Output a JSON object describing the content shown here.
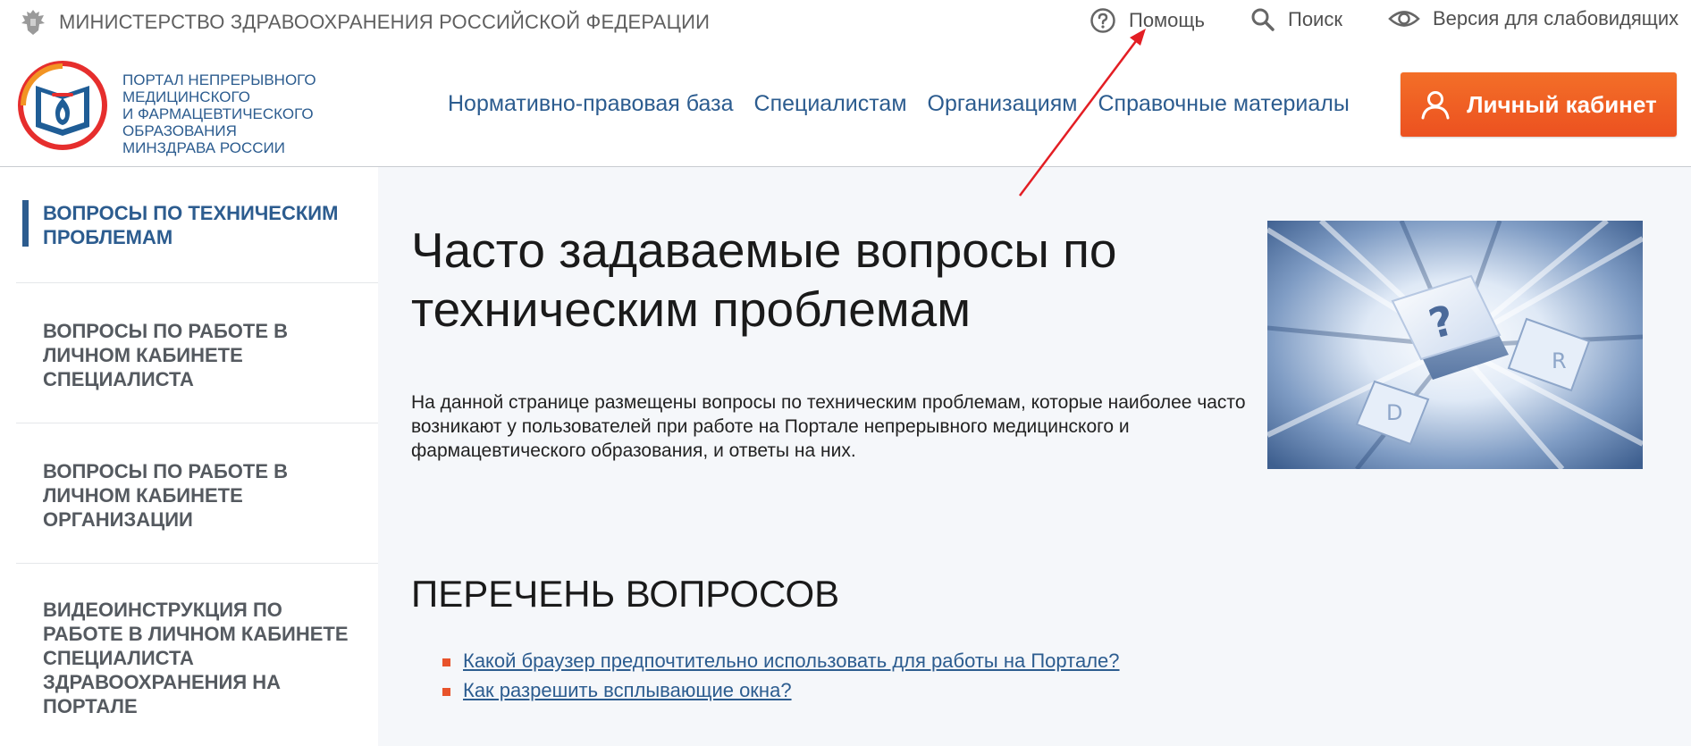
{
  "topbar": {
    "ministry": "МИНИСТЕРСТВО ЗДРАВООХРАНЕНИЯ РОССИЙСКОЙ ФЕДЕРАЦИИ",
    "help": "Помощь",
    "search": "Поиск",
    "accessibility": "Версия для слабовидящих"
  },
  "header": {
    "portal_lines": [
      "ПОРТАЛ НЕПРЕРЫВНОГО",
      "МЕДИЦИНСКОГО",
      "И ФАРМАЦЕВТИЧЕСКОГО ОБРАЗОВАНИЯ",
      "МИНЗДРАВА РОССИИ"
    ],
    "nav": [
      "Нормативно-правовая база",
      "Специалистам",
      "Организациям",
      "Справочные материалы"
    ],
    "cabinet_button": "Личный кабинет"
  },
  "sidebar": {
    "items": [
      {
        "label": "ВОПРОСЫ ПО ТЕХНИЧЕСКИМ ПРОБЛЕМАМ",
        "active": true
      },
      {
        "label": "ВОПРОСЫ ПО РАБОТЕ В ЛИЧНОМ КАБИНЕТЕ СПЕЦИАЛИСТА",
        "active": false
      },
      {
        "label": "ВОПРОСЫ ПО РАБОТЕ В ЛИЧНОМ КАБИНЕТЕ ОРГАНИЗАЦИИ",
        "active": false
      },
      {
        "label": "ВИДЕОИНСТРУКЦИЯ ПО РАБОТЕ В ЛИЧНОМ КАБИНЕТЕ СПЕЦИАЛИСТА ЗДРАВООХРАНЕНИЯ НА ПОРТАЛЕ",
        "active": false
      }
    ]
  },
  "main": {
    "title": "Часто задаваемые вопросы по техническим проблемам",
    "intro": "На данной странице размещены вопросы по техническим проблемам, которые наиболее часто возникают у пользователей при работе на Портале непрерывного медицинского и фармацевтического образования, и ответы на них.",
    "section_title": "ПЕРЕЧЕНЬ ВОПРОСОВ",
    "questions": [
      "Какой браузер предпочтительно использовать для работы на Портале?",
      "Как разрешить всплывающие окна?"
    ]
  },
  "colors": {
    "brand_blue": "#2c5c8f",
    "cta_orange": "#f15a24",
    "annotation_red": "#e31e24"
  },
  "icons": {
    "ministry": "eagle-emblem-icon",
    "help": "question-circle-icon",
    "search": "magnifier-icon",
    "accessibility": "eye-icon",
    "cabinet": "user-icon"
  }
}
